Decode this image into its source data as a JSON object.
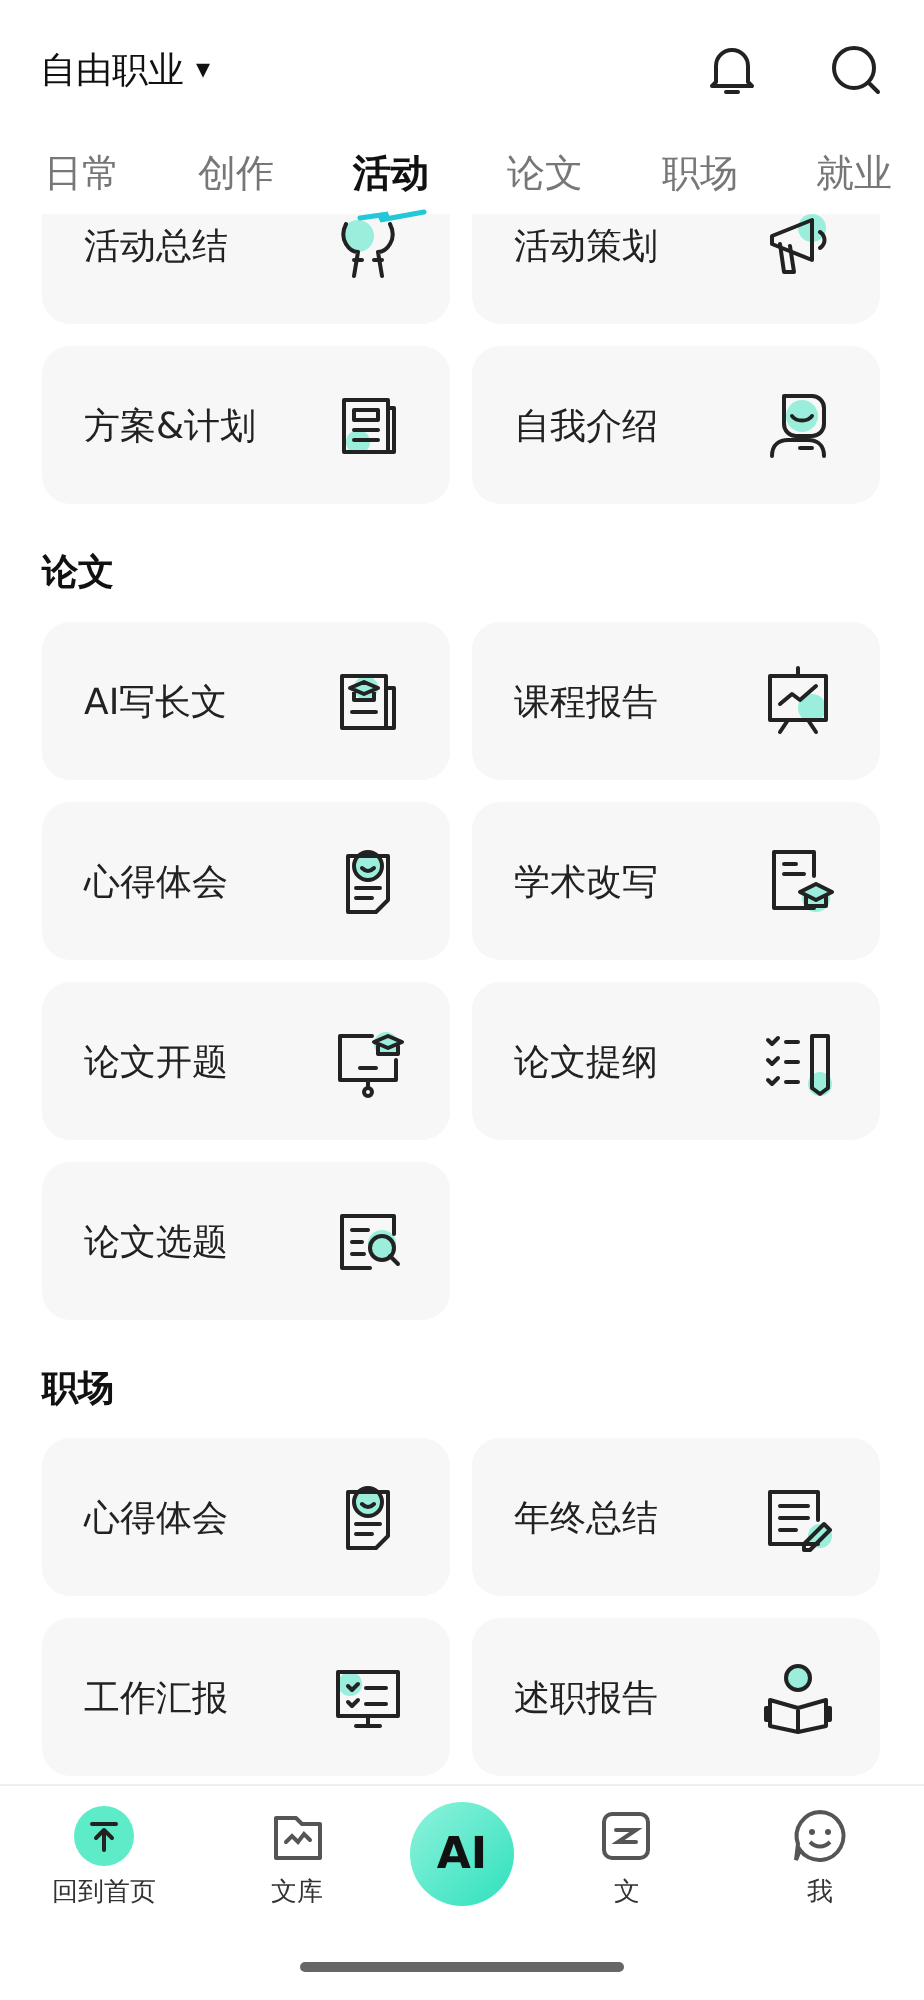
{
  "header": {
    "title": "自由职业",
    "caret": "▾"
  },
  "tabs": [
    {
      "label": "日常",
      "selected": false
    },
    {
      "label": "创作",
      "selected": false
    },
    {
      "label": "活动",
      "selected": true
    },
    {
      "label": "论文",
      "selected": false
    },
    {
      "label": "职场",
      "selected": false
    },
    {
      "label": "就业",
      "selected": false
    }
  ],
  "sections": [
    {
      "cards": [
        {
          "label": "活动总结"
        },
        {
          "label": "活动策划"
        },
        {
          "label": "方案&计划"
        },
        {
          "label": "自我介绍"
        }
      ]
    },
    {
      "title": "论文",
      "cards": [
        {
          "label": "AI写长文"
        },
        {
          "label": "课程报告"
        },
        {
          "label": "心得体会"
        },
        {
          "label": "学术改写"
        },
        {
          "label": "论文开题"
        },
        {
          "label": "论文提纲"
        },
        {
          "label": "论文选题"
        }
      ]
    },
    {
      "title": "职场",
      "cards": [
        {
          "label": "心得体会"
        },
        {
          "label": "年终总结"
        },
        {
          "label": "工作汇报"
        },
        {
          "label": "述职报告"
        }
      ]
    }
  ],
  "bottom_nav": [
    {
      "label": "回到首页",
      "kind": "home"
    },
    {
      "label": "文库",
      "kind": "library"
    },
    {
      "label": "AI",
      "kind": "ai"
    },
    {
      "label": "文",
      "kind": "doc"
    },
    {
      "label": "我",
      "kind": "me"
    }
  ]
}
